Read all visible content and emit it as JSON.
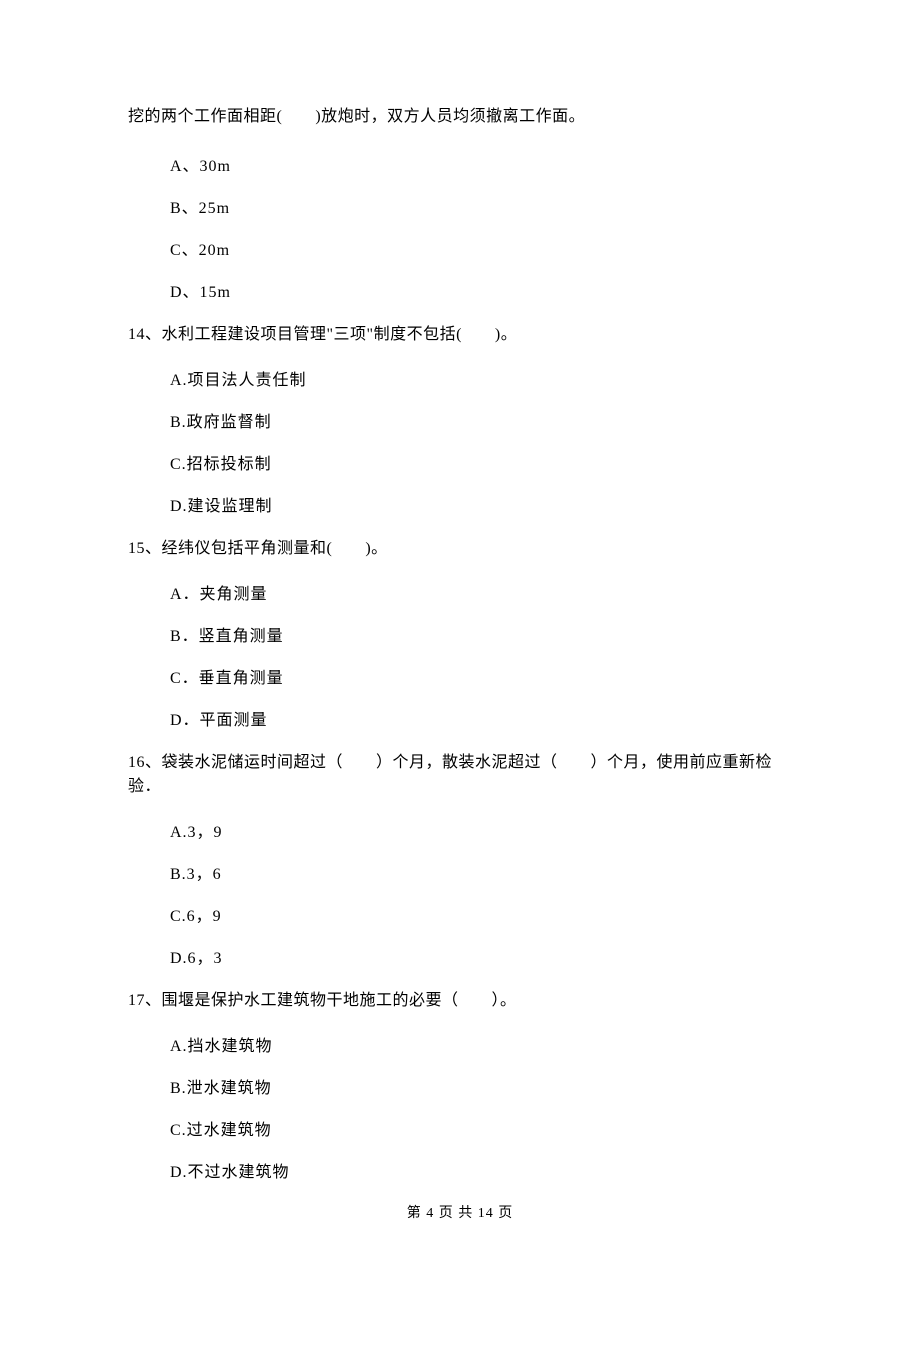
{
  "fragment_line": "挖的两个工作面相距(　　)放炮时，双方人员均须撤离工作面。",
  "fragment_options": {
    "a": "A、30m",
    "b": "B、25m",
    "c": "C、20m",
    "d": "D、15m"
  },
  "q14": {
    "stem": "14、水利工程建设项目管理\"三项\"制度不包括(　　)。",
    "a": "A.项目法人责任制",
    "b": "B.政府监督制",
    "c": "C.招标投标制",
    "d": "D.建设监理制"
  },
  "q15": {
    "stem": "15、经纬仪包括平角测量和(　　)。",
    "a": "A．夹角测量",
    "b": "B．竖直角测量",
    "c": "C．垂直角测量",
    "d": "D．平面测量"
  },
  "q16": {
    "stem": "16、袋装水泥储运时间超过（　　）个月，散装水泥超过（　　）个月，使用前应重新检验．",
    "a": "A.3，9",
    "b": "B.3，6",
    "c": "C.6，9",
    "d": "D.6，3"
  },
  "q17": {
    "stem": "17、围堰是保护水工建筑物干地施工的必要（　　）。",
    "a": "A.挡水建筑物",
    "b": "B.泄水建筑物",
    "c": "C.过水建筑物",
    "d": "D.不过水建筑物"
  },
  "footer": "第 4 页 共 14 页"
}
